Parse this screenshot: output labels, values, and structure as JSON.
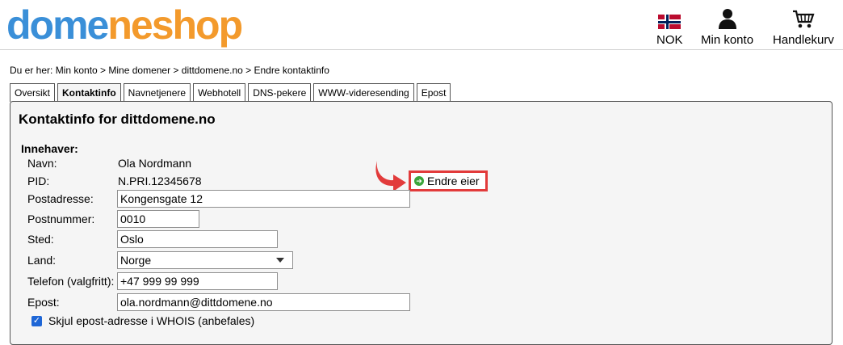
{
  "header": {
    "logo_part1": "dome",
    "logo_part2": "neshop",
    "currency_label": "NOK",
    "account_label": "Min konto",
    "cart_label": "Handlekurv",
    "icons": {
      "currency": "norway-flag-icon",
      "account": "user-icon",
      "cart": "cart-icon"
    }
  },
  "breadcrumb": {
    "text": "Du er her: Min konto > Mine domener > dittdomene.no > Endre kontaktinfo"
  },
  "tabs": [
    {
      "label": "Oversikt",
      "active": false
    },
    {
      "label": "Kontaktinfo",
      "active": true
    },
    {
      "label": "Navnetjenere",
      "active": false
    },
    {
      "label": "Webhotell",
      "active": false
    },
    {
      "label": "DNS-pekere",
      "active": false
    },
    {
      "label": "WWW-videresending",
      "active": false
    },
    {
      "label": "Epost",
      "active": false
    }
  ],
  "panel": {
    "title": "Kontaktinfo for dittdomene.no",
    "section": "Innehaver:",
    "labels": {
      "navn": "Navn:",
      "pid": "PID:",
      "postadresse": "Postadresse:",
      "postnummer": "Postnummer:",
      "sted": "Sted:",
      "land": "Land:",
      "telefon": "Telefon (valgfritt):",
      "epost": "Epost:"
    },
    "values": {
      "navn": "Ola Nordmann",
      "pid": "N.PRI.12345678",
      "postadresse": "Kongensgate 12",
      "postnummer": "0010",
      "sted": "Oslo",
      "land": "Norge",
      "telefon": "+47 999 99 999",
      "epost": "ola.nordmann@dittdomene.no"
    },
    "change_owner_button": "Endre eier",
    "hide_email_label": "Skjul epost-adresse i WHOIS (anbefales)",
    "hide_email_checked": true
  },
  "colors": {
    "logo_blue": "#3a8fd8",
    "logo_orange": "#f39a2c",
    "highlight_red": "#e23b3b",
    "panel_bg": "#f5f5f5"
  }
}
